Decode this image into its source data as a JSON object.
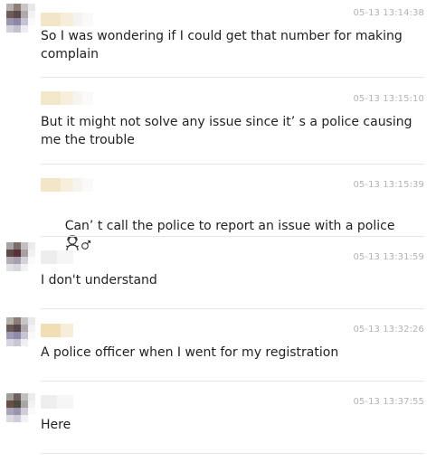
{
  "messages": [
    {
      "time": "05-13 13:14:38",
      "text": "So I was wondering if I could get that number for making complain",
      "avatar": "blurred-avatar"
    },
    {
      "time": "05-13 13:15:10",
      "text": "But it might not solve any issue since it’ s a police causing me the trouble"
    },
    {
      "time": "05-13 13:15:39",
      "text": "Can’ t call the police to report an issue with a police",
      "emoji": "woman-shrugging-emoji"
    },
    {
      "time": "05-13 13:31:59",
      "text": "I don't understand",
      "avatar": "blurred-avatar"
    },
    {
      "time": "05-13 13:32:26",
      "text": "A police officer when I went for my registration",
      "avatar": "blurred-avatar"
    },
    {
      "time": "05-13 13:37:55",
      "text": "Here",
      "avatar": "blurred-avatar"
    }
  ],
  "colors": {
    "text": "#222222",
    "timestamp": "#b3b3b3",
    "divider": "#e6e6e6",
    "name_blur": "#f2e6c8"
  }
}
